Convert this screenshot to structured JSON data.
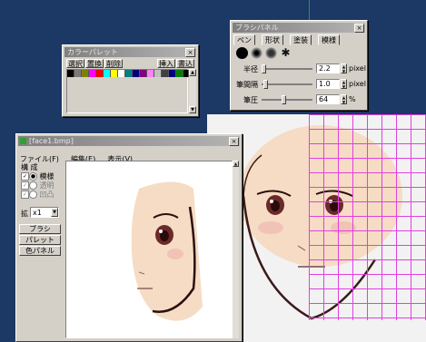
{
  "colors": {
    "desktop": "#1c3864",
    "grid": "#e040e0",
    "skin": "#f6dcc4"
  },
  "color_palette": {
    "title": "カラーパレット",
    "close": "×",
    "buttons": [
      "選択",
      "置換",
      "削除",
      "挿入",
      "書込"
    ],
    "swatches": [
      "#000000",
      "#7a7a7a",
      "#808000",
      "#ff00ff",
      "#ff0000",
      "#00ffff",
      "#ffff00",
      "#ffffff",
      "#008080",
      "#000080",
      "#800080",
      "#ff80ff",
      "#c0c0c0",
      "#404040",
      "#000080",
      "#008000",
      "#000000"
    ]
  },
  "brush_panel": {
    "title": "ブラシパネル",
    "close": "×",
    "tabs": [
      "ペン",
      "形状",
      "塗装",
      "模様"
    ],
    "rows": [
      {
        "label": "半径",
        "value": "2.2",
        "unit": "pixel"
      },
      {
        "label": "筆間隔",
        "value": "1.0",
        "unit": "pixel"
      },
      {
        "label": "筆圧",
        "value": "64",
        "unit": "%"
      }
    ]
  },
  "image_window": {
    "title": "[face1.bmp]",
    "close": "×",
    "menu": [
      "ファイル(F)",
      "編集(E)",
      "表示(V)"
    ],
    "group_label": "構 成",
    "options": [
      "模様",
      "透明",
      "凹凸"
    ],
    "zoom_label": "拡",
    "zoom_value": "x1",
    "buttons": [
      "ブラシ",
      "パレット",
      "色パネル"
    ]
  }
}
